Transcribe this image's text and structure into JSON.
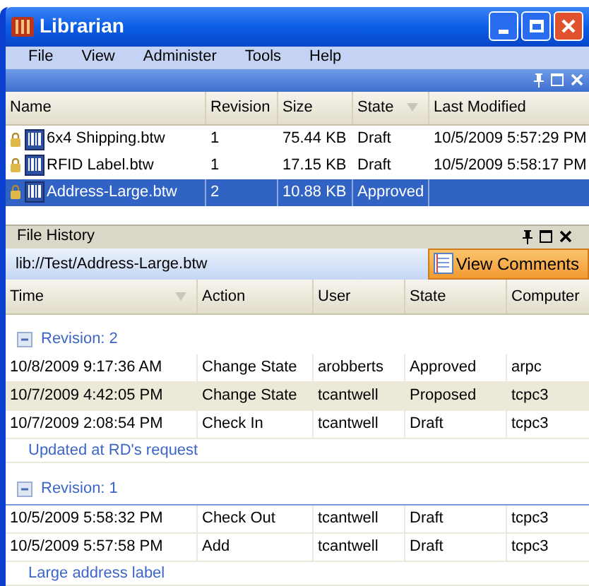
{
  "window": {
    "title": "Librarian"
  },
  "menu": [
    "File",
    "View",
    "Administer",
    "Tools",
    "Help"
  ],
  "files": {
    "columns": [
      {
        "label": "Name",
        "sorted": false
      },
      {
        "label": "Revision",
        "sorted": false
      },
      {
        "label": "Size",
        "sorted": false
      },
      {
        "label": "State",
        "sorted": true
      },
      {
        "label": "Last Modified",
        "sorted": false
      }
    ],
    "rows": [
      {
        "name": "6x4 Shipping.btw",
        "revision": "1",
        "size": "75.44 KB",
        "state": "Draft",
        "last_modified": "10/5/2009 5:57:29 PM",
        "selected": false
      },
      {
        "name": "RFID Label.btw",
        "revision": "1",
        "size": "17.15 KB",
        "state": "Draft",
        "last_modified": "10/5/2009 5:58:17 PM",
        "selected": false
      },
      {
        "name": "Address-Large.btw",
        "revision": "2",
        "size": "10.88 KB",
        "state": "Approved",
        "selected": true
      }
    ]
  },
  "history": {
    "title": "File History",
    "path": "lib://Test/Address-Large.btw",
    "button": "View Comments",
    "columns": [
      {
        "label": "Time",
        "sorted": true
      },
      {
        "label": "Action",
        "sorted": false
      },
      {
        "label": "User",
        "sorted": false
      },
      {
        "label": "State",
        "sorted": false
      },
      {
        "label": "Computer",
        "sorted": false
      }
    ],
    "groups": [
      {
        "title": "Revision: 2",
        "expanded": true,
        "entries": [
          {
            "time": "10/8/2009 9:17:36 AM",
            "action": "Change State",
            "user": "arobberts",
            "state": "Approved",
            "computer": "arpc",
            "selected": false
          },
          {
            "time": "10/7/2009 4:42:05 PM",
            "action": "Change State",
            "user": "tcantwell",
            "state": "Proposed",
            "computer": "tcpc3",
            "selected": true
          },
          {
            "time": "10/7/2009 2:08:54 PM",
            "action": "Check In",
            "user": "tcantwell",
            "state": "Draft",
            "computer": "tcpc3",
            "selected": false
          }
        ],
        "comment": "Updated at RD's request"
      },
      {
        "title": "Revision: 1",
        "expanded": true,
        "entries": [
          {
            "time": "10/5/2009 5:58:32 PM",
            "action": "Check Out",
            "user": "tcantwell",
            "state": "Draft",
            "computer": "tcpc3",
            "selected": false
          },
          {
            "time": "10/5/2009 5:57:58 PM",
            "action": "Add",
            "user": "tcantwell",
            "state": "Draft",
            "computer": "tcpc3",
            "selected": false
          }
        ],
        "comment": "Large address label"
      }
    ]
  }
}
